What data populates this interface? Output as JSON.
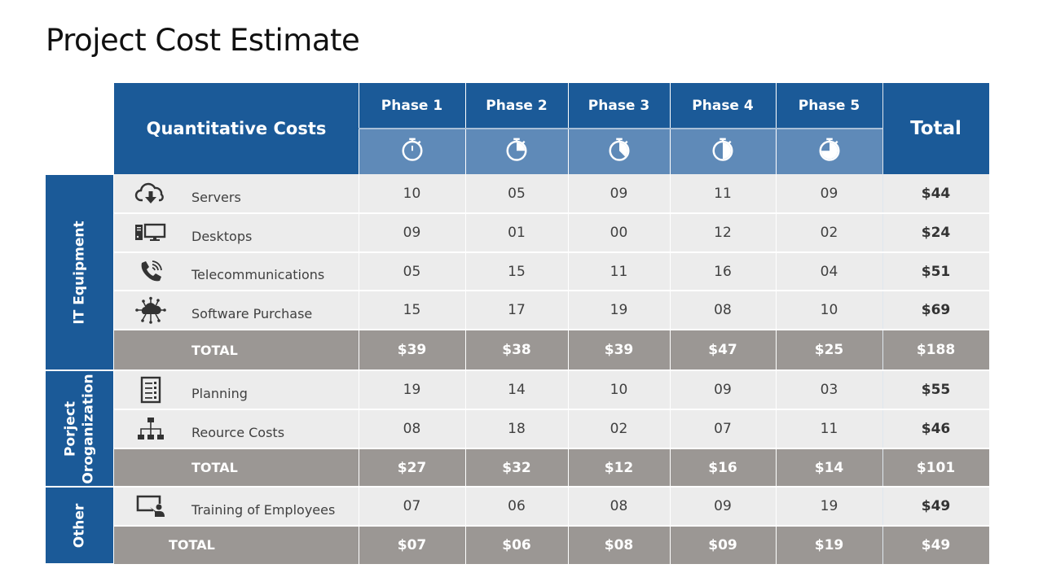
{
  "title": "Project Cost Estimate",
  "header": {
    "section_label": "Quantitative Costs",
    "phases": [
      {
        "label": "Phase 1",
        "icon": "stopwatch-icon",
        "progress": 0
      },
      {
        "label": "Phase 2",
        "icon": "stopwatch-icon",
        "progress": 0.25
      },
      {
        "label": "Phase 3",
        "icon": "stopwatch-icon",
        "progress": 0.375
      },
      {
        "label": "Phase 4",
        "icon": "stopwatch-icon",
        "progress": 0.5
      },
      {
        "label": "Phase 5",
        "icon": "stopwatch-icon",
        "progress": 0.75
      }
    ],
    "total_label": "Total"
  },
  "groups": [
    {
      "category": "IT Equipment",
      "rows": [
        {
          "icon": "cloud-download-icon",
          "label": "Servers",
          "values": [
            "10",
            "05",
            "09",
            "11",
            "09"
          ],
          "total": "$44"
        },
        {
          "icon": "desktop-computer-icon",
          "label": "Desktops",
          "values": [
            "09",
            "01",
            "00",
            "12",
            "02"
          ],
          "total": "$24"
        },
        {
          "icon": "phone-call-icon",
          "label": "Telecommunications",
          "values": [
            "05",
            "15",
            "11",
            "16",
            "04"
          ],
          "total": "$51"
        },
        {
          "icon": "cloud-network-icon",
          "label": "Software Purchase",
          "values": [
            "15",
            "17",
            "19",
            "08",
            "10"
          ],
          "total": "$69"
        }
      ],
      "total_row": {
        "label": "TOTAL",
        "values": [
          "$39",
          "$38",
          "$39",
          "$47",
          "$25"
        ],
        "total": "$188"
      }
    },
    {
      "category": "Porject Oroganization",
      "category_lines": [
        "Porject",
        "Oroganization"
      ],
      "rows": [
        {
          "icon": "checklist-icon",
          "label": "Planning",
          "values": [
            "19",
            "14",
            "10",
            "09",
            "03"
          ],
          "total": "$55"
        },
        {
          "icon": "org-chart-icon",
          "label": "Reource Costs",
          "values": [
            "08",
            "18",
            "02",
            "07",
            "11"
          ],
          "total": "$46"
        }
      ],
      "total_row": {
        "label": "TOTAL",
        "values": [
          "$27",
          "$32",
          "$12",
          "$16",
          "$14"
        ],
        "total": "$101"
      }
    },
    {
      "category": "Other",
      "rows": [
        {
          "icon": "presentation-training-icon",
          "label": "Training of Employees",
          "values": [
            "07",
            "06",
            "08",
            "09",
            "19"
          ],
          "total": "$49"
        }
      ],
      "total_row": {
        "label": "TOTAL",
        "values": [
          "$07",
          "$06",
          "$08",
          "$09",
          "$19"
        ],
        "total": "$49"
      }
    }
  ],
  "colors": {
    "header_blue": "#1b5a98",
    "icon_row_blue": "#5f8ab8",
    "row_gray": "#ececec",
    "total_gray": "#9b9794"
  }
}
